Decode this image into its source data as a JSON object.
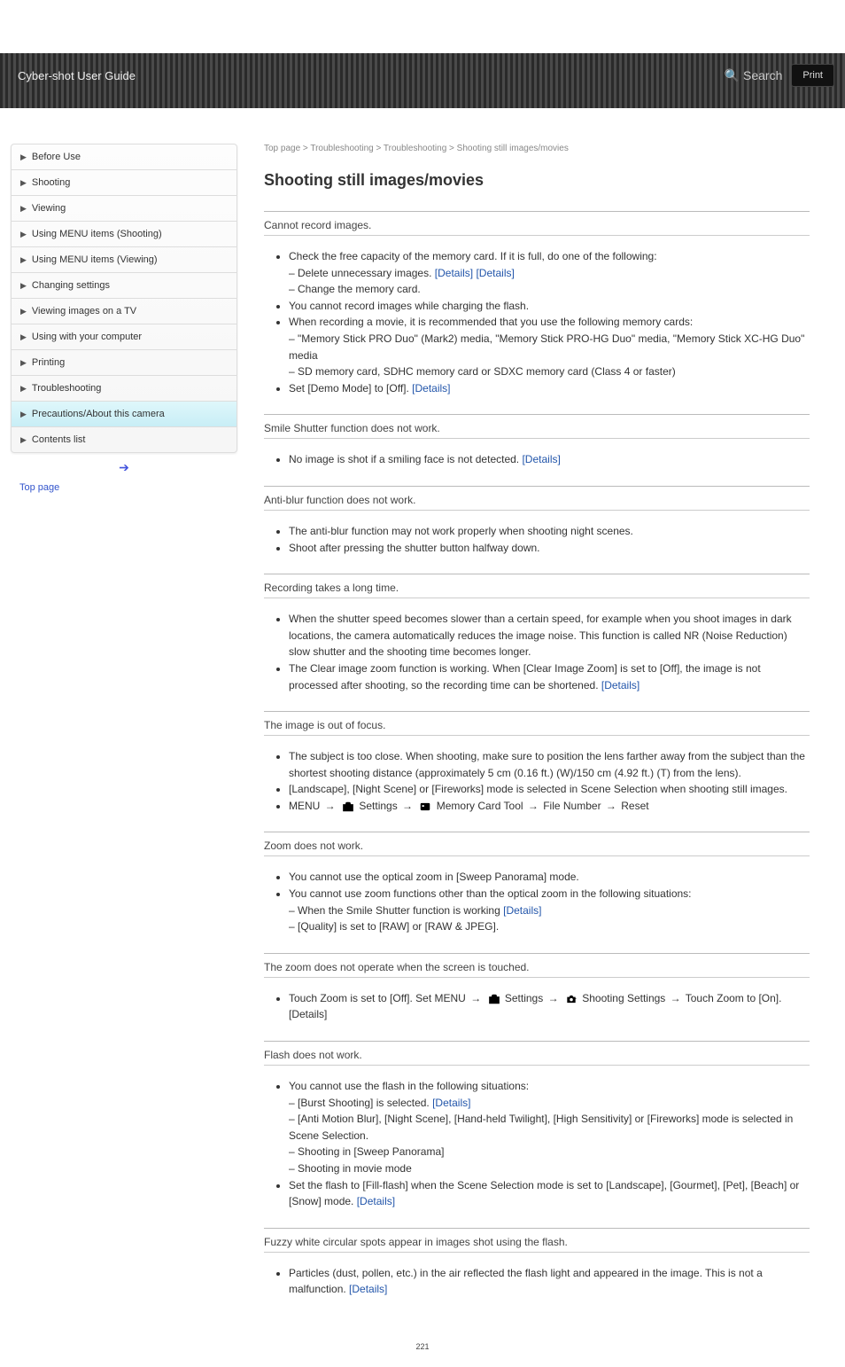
{
  "header": {
    "title": "Cyber-shot User Guide",
    "print_label": "Print",
    "search_label": "Search"
  },
  "sidebar": {
    "items": [
      {
        "label": "Before Use"
      },
      {
        "label": "Shooting"
      },
      {
        "label": "Viewing"
      },
      {
        "label": "Using MENU items (Shooting)"
      },
      {
        "label": "Using MENU items (Viewing)"
      },
      {
        "label": "Changing settings"
      },
      {
        "label": "Viewing images on a TV"
      },
      {
        "label": "Using with your computer"
      },
      {
        "label": "Printing"
      },
      {
        "label": "Troubleshooting"
      },
      {
        "label": "Precautions/About this camera"
      }
    ],
    "contents_label": "Contents list"
  },
  "top_link": {
    "label": "Top page",
    "href": "#"
  },
  "breadcrumb": "Top page > Troubleshooting > Troubleshooting > Shooting still images/movies",
  "content": {
    "h1": "Shooting still images/movies",
    "rows": [
      {
        "title": "Cannot record images.",
        "bullets": [
          "Check the free capacity of the memory card. If it is full, do one of the following:\n– Delete unnecessary images. [Details] [Details]\n– Change the memory card.",
          "You cannot record images while charging the flash.",
          "When recording a movie, it is recommended that you use the following memory cards:\n– \"Memory Stick PRO Duo\" (Mark2) media, \"Memory Stick PRO-HG Duo\" media, \"Memory Stick XC-HG Duo\" media\n– SD memory card, SDHC memory card or SDXC memory card (Class 4 or faster)",
          "Set [Demo Mode] to [Off]. [Details]"
        ]
      },
      {
        "title": "Smile Shutter function does not work.",
        "bullets": [
          "No image is shot if a smiling face is not detected. [Details]"
        ]
      },
      {
        "title": "Anti-blur function does not work.",
        "bullets": [
          "The anti-blur function may not work properly when shooting night scenes.",
          "Shoot after pressing the shutter button halfway down."
        ]
      },
      {
        "title": "Recording takes a long time.",
        "bullets": [
          "When the shutter speed becomes slower than a certain speed, for example when you shoot images in dark locations, the camera automatically reduces the image noise. This function is called NR (Noise Reduction) slow shutter and the shooting time becomes longer.",
          "The Clear image zoom function is working. When [Clear Image Zoom] is set to [Off], the image is not processed after shooting, so the recording time can be shortened. [Details]"
        ]
      },
      {
        "title": "The image is out of focus.",
        "bullets": [
          "The subject is too close. When shooting, make sure to position the lens farther away from the subject than the shortest shooting distance (approximately 5 cm (0.16 ft.) (W)/150 cm (4.92 ft.) (T) from the lens).",
          "[Landscape], [Night Scene] or [Fireworks] mode is selected in Scene Selection when shooting still images.",
          "MENU_TOOLBOX_CARD_PATH"
        ]
      },
      {
        "title": "Zoom does not work.",
        "bullets": [
          "You cannot use the optical zoom in [Sweep Panorama] mode.",
          "You cannot use zoom functions other than the optical zoom in the following situations:\n– When the Smile Shutter function is working [Details]\n– [Quality] is set to [RAW] or [RAW & JPEG]."
        ]
      },
      {
        "title": "The zoom does not operate when the screen is touched.",
        "bullets": [
          "ZOOM_TOUCH_PATH"
        ]
      },
      {
        "title": "Flash does not work.",
        "bullets": [
          "You cannot use the flash in the following situations:\n– [Burst Shooting] is selected. [Details]\n– [Anti Motion Blur], [Night Scene], [Hand-held Twilight], [High Sensitivity] or [Fireworks] mode is selected in Scene Selection.\n– Shooting in [Sweep Panorama]\n– Shooting in movie mode",
          "Set the flash to [Fill-flash] when the Scene Selection mode is set to [Landscape], [Gourmet], [Pet], [Beach] or [Snow] mode. [Details]"
        ]
      },
      {
        "title": "Fuzzy white circular spots appear in images shot using the flash.",
        "bullets": [
          "Particles (dust, pollen, etc.) in the air reflected the flash light and appeared in the image. This is not a malfunction. [Details]"
        ]
      }
    ],
    "menu_path": {
      "prefix": "MENU ",
      "settings": "Settings",
      "memory_tool": "Memory Card Tool",
      "file_number": "File Number",
      "reset": "Reset",
      "shooting_settings": "Shooting Settings",
      "touch_zoom": "Touch Zoom",
      "touch_zoom_tail": ". [Details]",
      "zoom_touch_sentence": "Touch Zoom is set to [Off]. Set MENU ",
      "zoom_touch_mid": " to [On]"
    }
  },
  "page_number": "221"
}
